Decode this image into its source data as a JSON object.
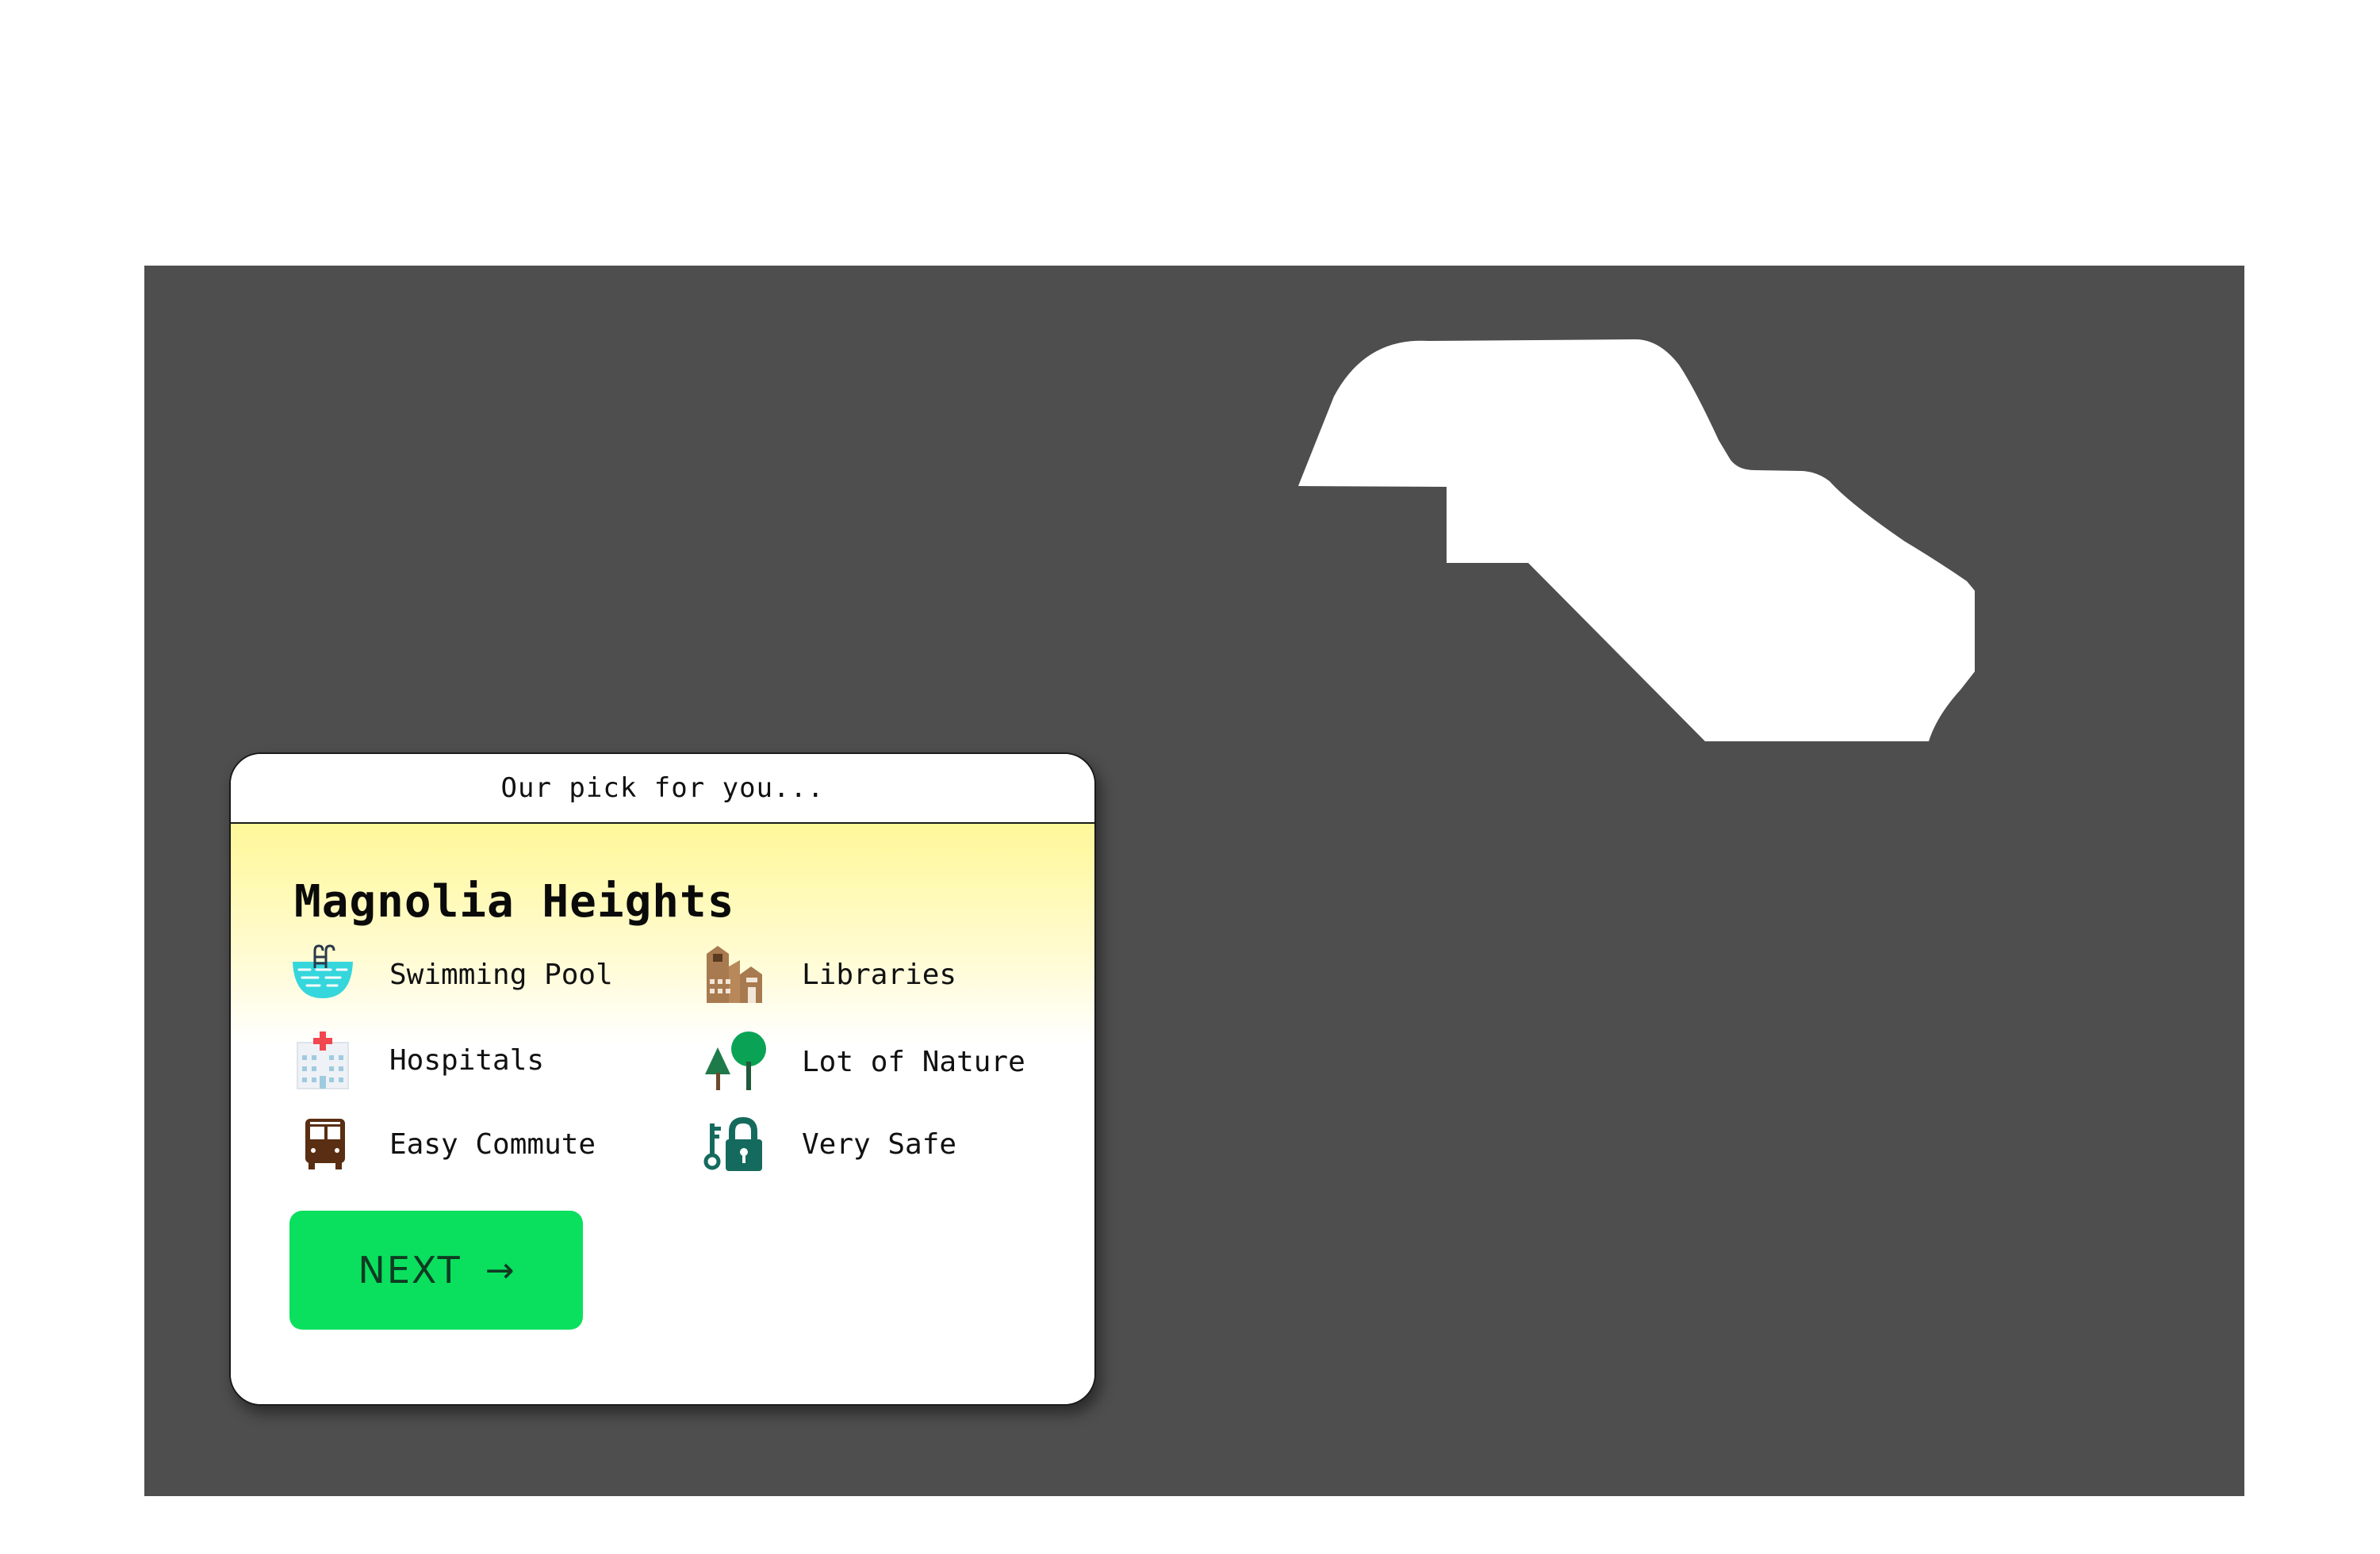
{
  "map": {
    "background_color": "#4e4e4e",
    "region_color": "#ffffff"
  },
  "card": {
    "header": "Our pick for you...",
    "title": "Magnolia Heights",
    "features": [
      {
        "icon": "swimming-pool-icon",
        "label": "Swimming Pool"
      },
      {
        "icon": "library-building-icon",
        "label": "Libraries"
      },
      {
        "icon": "hospital-icon",
        "label": "Hospitals"
      },
      {
        "icon": "trees-icon",
        "label": "Lot of Nature"
      },
      {
        "icon": "bus-icon",
        "label": "Easy Commute"
      },
      {
        "icon": "key-lock-icon",
        "label": "Very Safe"
      }
    ],
    "next_label": "NEXT",
    "next_arrow": "→",
    "button_color": "#0bdf5e"
  }
}
